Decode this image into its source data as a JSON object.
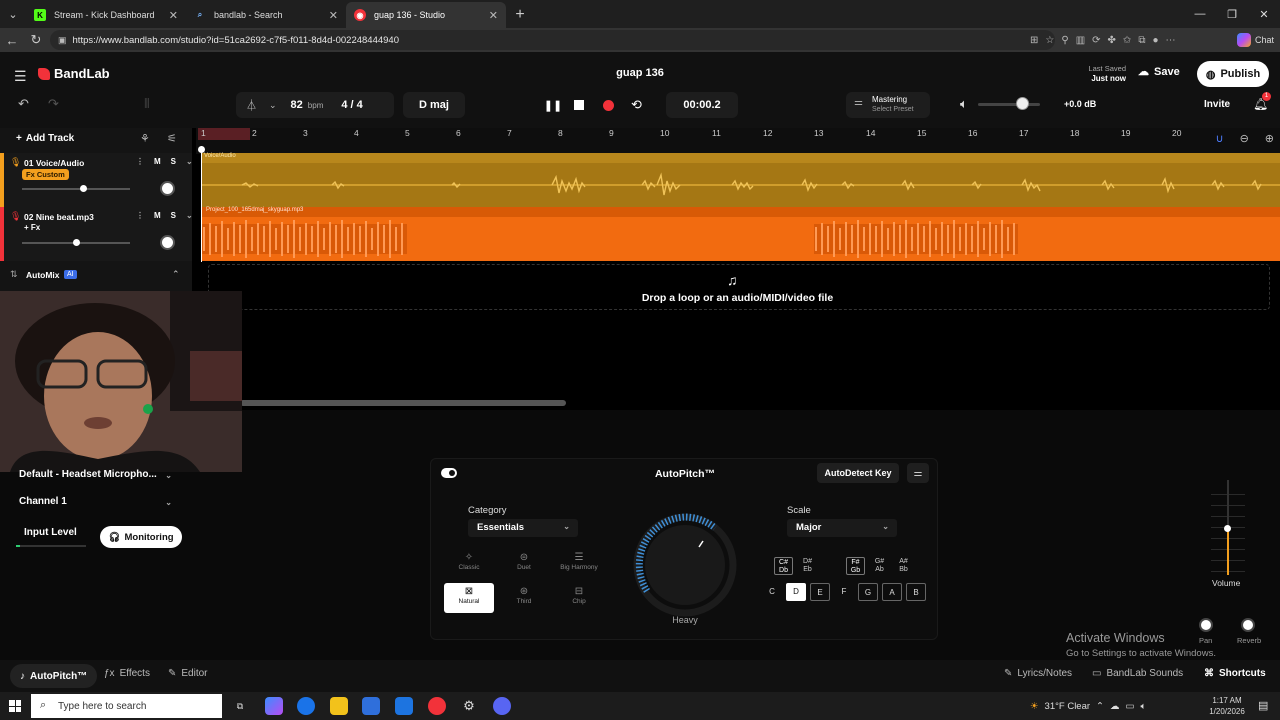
{
  "browser": {
    "tabs": [
      {
        "title": "Stream - Kick Dashboard",
        "active": false
      },
      {
        "title": "bandlab - Search",
        "active": false
      },
      {
        "title": "guap 136 - Studio",
        "active": true
      }
    ],
    "url": "https://www.bandlab.com/studio?id=51ca2692-c7f5-f011-8d4d-002248444940",
    "chat_label": "Chat"
  },
  "header": {
    "logo": "BandLab",
    "project_title": "guap 136",
    "last_saved_label": "Last Saved",
    "last_saved_value": "Just now",
    "save_label": "Save",
    "publish_label": "Publish",
    "invite_label": "Invite",
    "notification_count": "1"
  },
  "toolbar": {
    "bpm": "82",
    "bpm_unit": "bpm",
    "time_signature": "4 / 4",
    "key": "D maj",
    "time": "00:00.2",
    "mastering_label": "Mastering",
    "mastering_preset": "Select Preset",
    "volume_db": "+0.0 dB"
  },
  "tracks": {
    "add_track_label": "Add Track",
    "items": [
      {
        "name": "01  Voice/Audio",
        "fx": "Fx Custom",
        "clip": "Voice/Audio",
        "color": "#f39f1e"
      },
      {
        "name": "02  Nine beat.mp3",
        "fx": "+ Fx",
        "clip": "Project_100_165dmaj_skyguap.mp3",
        "color": "#f2323a"
      }
    ],
    "mute": "M",
    "solo": "S",
    "automix": "AutoMix",
    "automix_badge": "AI",
    "ruler": [
      "1",
      "2",
      "3",
      "4",
      "5",
      "6",
      "7",
      "8",
      "9",
      "10",
      "11",
      "12",
      "13",
      "14",
      "15",
      "16",
      "17",
      "18",
      "19",
      "20"
    ],
    "drop_text": "Drop a loop or an audio/MIDI/video file"
  },
  "input": {
    "device": "Default - Headset Micropho...",
    "channel": "Channel 1",
    "input_level_label": "Input Level",
    "monitoring_label": "Monitoring"
  },
  "autopitch": {
    "title": "AutoPitch™",
    "autodetect_label": "AutoDetect Key",
    "category_label": "Category",
    "category_value": "Essentials",
    "presets": [
      {
        "name": "Classic",
        "active": false
      },
      {
        "name": "Duet",
        "active": false
      },
      {
        "name": "Big Harmony",
        "active": false
      },
      {
        "name": "Natural",
        "active": true
      },
      {
        "name": "Third",
        "active": false
      },
      {
        "name": "Chip",
        "active": false
      }
    ],
    "dial_label": "Heavy",
    "scale_label": "Scale",
    "scale_value": "Major",
    "black_keys": [
      {
        "top": "C#",
        "bottom": "Db"
      },
      {
        "top": "D#",
        "bottom": "Eb"
      },
      {
        "top": "F#",
        "bottom": "Gb"
      },
      {
        "top": "G#",
        "bottom": "Ab"
      },
      {
        "top": "A#",
        "bottom": "Bb"
      }
    ],
    "white_keys": [
      "C",
      "D",
      "E",
      "F",
      "G",
      "A",
      "B"
    ],
    "selected_key": "D"
  },
  "mixer": {
    "volume_label": "Volume",
    "pan_label": "Pan",
    "reverb_label": "Reverb"
  },
  "watermark": {
    "title": "Activate Windows",
    "subtitle": "Go to Settings to activate Windows."
  },
  "bottombar": {
    "autopitch_tab": "AutoPitch™",
    "effects_tab": "Effects",
    "editor_tab": "Editor",
    "lyrics_label": "Lyrics/Notes",
    "sounds_label": "BandLab Sounds",
    "shortcuts_label": "Shortcuts"
  },
  "taskbar": {
    "search_placeholder": "Type here to search",
    "weather": "31°F  Clear",
    "time": "1:17 AM",
    "date": "1/20/2026"
  }
}
